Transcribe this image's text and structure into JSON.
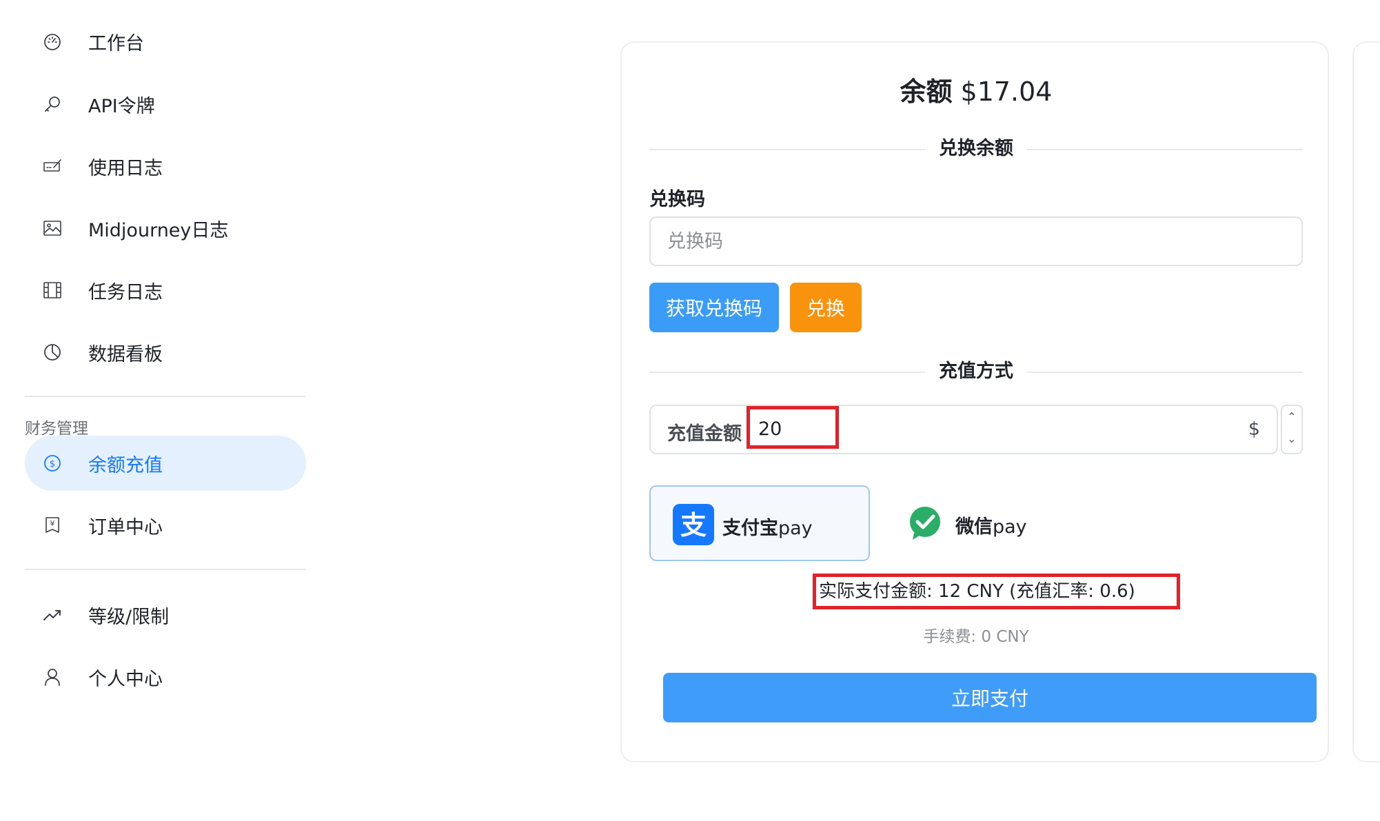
{
  "sidebar": {
    "items": [
      {
        "label": "工作台",
        "icon": "dashboard-icon"
      },
      {
        "label": "API令牌",
        "icon": "key-icon"
      },
      {
        "label": "使用日志",
        "icon": "log-icon"
      },
      {
        "label": "Midjourney日志",
        "icon": "image-icon"
      },
      {
        "label": "任务日志",
        "icon": "film-icon"
      },
      {
        "label": "数据看板",
        "icon": "pie-chart-icon"
      }
    ],
    "finance_group_title": "财务管理",
    "finance_items": [
      {
        "label": "余额充值",
        "icon": "dollar-circle-icon",
        "active": true
      },
      {
        "label": "订单中心",
        "icon": "order-icon"
      }
    ],
    "bottom_items": [
      {
        "label": "等级/限制",
        "icon": "trending-up-icon"
      },
      {
        "label": "个人中心",
        "icon": "user-icon"
      }
    ]
  },
  "main": {
    "balance_label": "余额",
    "balance_value": "$17.04",
    "redeem_section_title": "兑换余额",
    "redeem_code_label": "兑换码",
    "redeem_code_placeholder": "兑换码",
    "get_code_button": "获取兑换码",
    "redeem_button": "兑换",
    "topup_section_title": "充值方式",
    "amount_label": "充值金额",
    "amount_value": "20",
    "amount_unit": "$",
    "payment_methods": [
      {
        "name_cn": "支付宝",
        "name_en": "pay",
        "icon": "alipay-icon",
        "selected": true
      },
      {
        "name_cn": "微信",
        "name_en": "pay",
        "icon": "wechat-pay-icon",
        "selected": false
      }
    ],
    "actual_payment_text": "实际支付金额: 12 CNY (充值汇率: 0.6)",
    "fee_text": "手续费: 0 CNY",
    "pay_now_button": "立即支付"
  },
  "colors": {
    "primary": "#409cf9",
    "redeem_orange": "#f9920c",
    "active_nav_bg": "#e4f0fd",
    "highlight_red": "#e2222a",
    "alipay_blue": "#1677ff",
    "wechat_green": "#2aae67"
  }
}
